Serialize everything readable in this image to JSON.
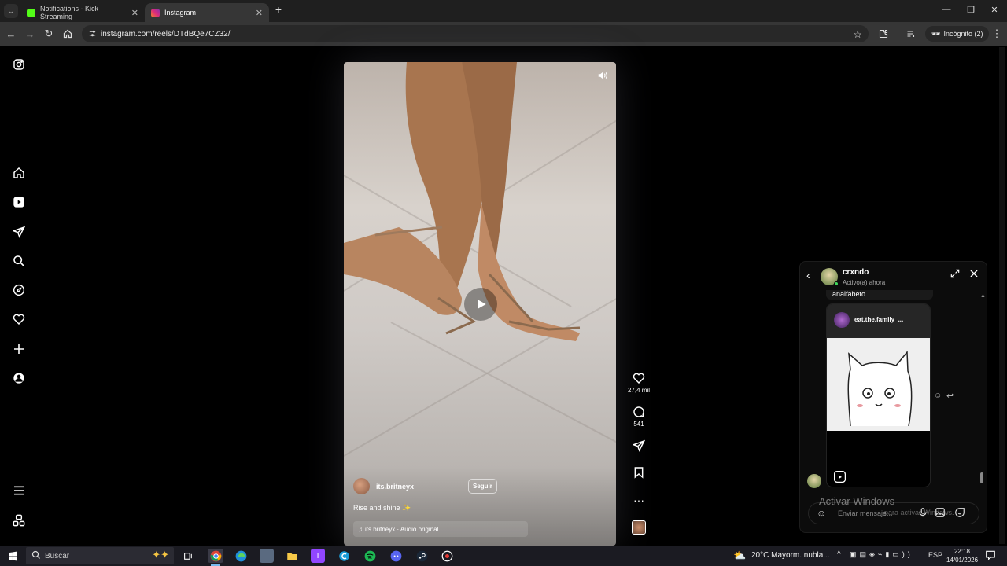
{
  "browser": {
    "tabs": [
      {
        "title": "Notifications - Kick Streaming",
        "favicon_color": "#53fc18"
      },
      {
        "title": "Instagram",
        "favicon_color": "#e1306c"
      }
    ],
    "url": "instagram.com/reels/DTdBQe7CZ32/",
    "incognito_label": "Incógnito (2)"
  },
  "sidebar": {
    "icons": [
      "instagram-logo-icon",
      "home-icon",
      "reels-icon",
      "direct-icon",
      "search-icon",
      "explore-icon",
      "heart-icon",
      "create-icon",
      "profile-icon",
      "menu-icon",
      "threads-icon"
    ]
  },
  "reel": {
    "username": "its.britneyx",
    "follow_label": "Seguir",
    "caption": "Rise and shine ✨",
    "audio": "its.britneyx · Audio original",
    "likes": "27,4 mil",
    "comments": "541"
  },
  "dm": {
    "username": "crxndo",
    "status": "Activo(a) ahora",
    "prev_message": "analfabeto",
    "shared_account": "eat.the.family_...",
    "input_placeholder": "Enviar mensaje...",
    "watermark_title": "Activar Windows",
    "watermark_sub": "para activar Windows."
  },
  "taskbar": {
    "search_placeholder": "Buscar",
    "weather": "20°C  Mayorm. nubla...",
    "lang": "ESP",
    "time": "22:18",
    "date": "14/01/2026"
  },
  "colors": {
    "page_bg": "#000000",
    "accent": "#0095f6"
  }
}
